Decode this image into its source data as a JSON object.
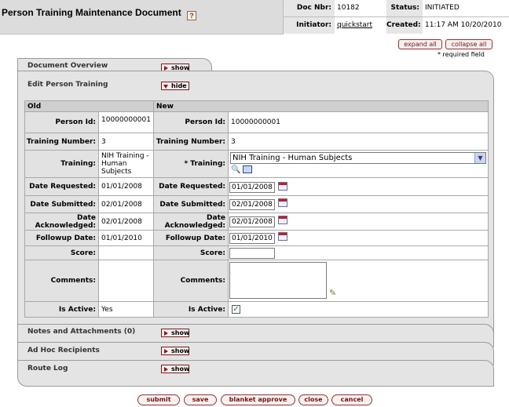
{
  "header": {
    "title": "Person Training Maintenance Document",
    "help": "?",
    "doc_nbr_label": "Doc Nbr:",
    "doc_nbr": "10182",
    "status_label": "Status:",
    "status": "INITIATED",
    "initiator_label": "Initiator:",
    "initiator": "quickstart",
    "created_label": "Created:",
    "created": "11:17 AM 10/20/2010"
  },
  "actions": {
    "expand_all": "expand all",
    "collapse_all": "collapse all",
    "required_note": "* required field"
  },
  "tabs": {
    "document_overview": "Document Overview",
    "edit_person_training": "Edit Person Training",
    "notes": "Notes and Attachments (0)",
    "adhoc": "Ad Hoc Recipients",
    "route_log": "Route Log",
    "show": "show",
    "hide": "hide"
  },
  "table": {
    "old_header": "Old",
    "new_header": "New",
    "labels": {
      "person_id": "Person Id:",
      "training_number": "Training Number:",
      "training": "Training:",
      "training_req": "*  Training:",
      "date_requested": "Date Requested:",
      "date_submitted": "Date Submitted:",
      "date_acknowledged": "Date Acknowledged:",
      "followup_date": "Followup Date:",
      "score": "Score:",
      "comments": "Comments:",
      "is_active": "Is Active:"
    },
    "old": {
      "person_id": "10000000001",
      "training_number": "3",
      "training": "NIH Training - Human Subjects",
      "date_requested": "01/01/2008",
      "date_submitted": "02/01/2008",
      "date_acknowledged": "02/01/2008",
      "followup_date": "01/01/2010",
      "score": "",
      "comments": "",
      "is_active": "Yes"
    },
    "new": {
      "person_id": "10000000001",
      "training_number": "3",
      "training": "NIH Training - Human Subjects",
      "date_requested": "01/01/2008",
      "date_submitted": "02/01/2008",
      "date_acknowledged": "02/01/2008",
      "followup_date": "01/01/2010",
      "score": "",
      "comments": "",
      "is_active": true
    }
  },
  "buttons": {
    "submit": "submit",
    "save": "save",
    "blanket_approve": "blanket approve",
    "close": "close",
    "cancel": "cancel"
  }
}
